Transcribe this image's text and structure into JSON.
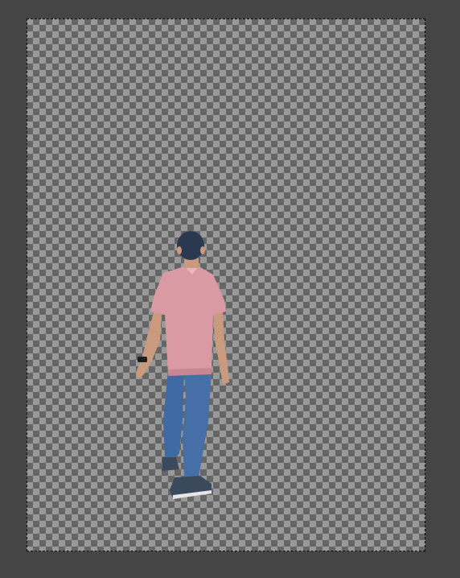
{
  "editor": {
    "workspace_background": "#454545",
    "canvas": {
      "transparency_pattern": "checkerboard",
      "checker_light": "#999999",
      "checker_dark": "#666666"
    },
    "selection": {
      "type": "marching-ants",
      "color_a": "#ffffff",
      "color_b": "#000000"
    },
    "layer": {
      "content": "person-cutout",
      "colors": {
        "shirt": "#d99aa3",
        "jeans": "#3f6aa3",
        "hair": "#27344a",
        "skin": "#c99a7e",
        "shoes": "#3a4a5c"
      }
    }
  }
}
